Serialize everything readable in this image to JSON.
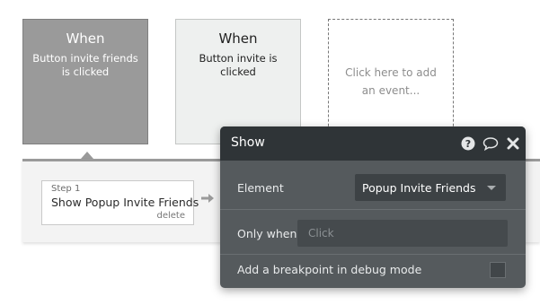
{
  "events": [
    {
      "title": "When",
      "description": "Button invite friends is clicked"
    },
    {
      "title": "When",
      "description": "Button invite is clicked"
    }
  ],
  "add_event": {
    "label": "Click here to add an event..."
  },
  "step": {
    "number_label": "Step 1",
    "title": "Show Popup Invite Friends",
    "delete_label": "delete"
  },
  "panel": {
    "title": "Show",
    "icons": [
      "help-icon",
      "comment-icon",
      "close-icon"
    ],
    "element_label": "Element",
    "element_value": "Popup Invite Friends",
    "only_when_label": "Only when",
    "only_when_placeholder": "Click",
    "breakpoint_label": "Add a breakpoint in debug mode",
    "breakpoint_checked": false
  },
  "colors": {
    "selected_event": "#9a9a9a",
    "panel_bg": "#555a5d",
    "panel_header": "#2f3437"
  }
}
